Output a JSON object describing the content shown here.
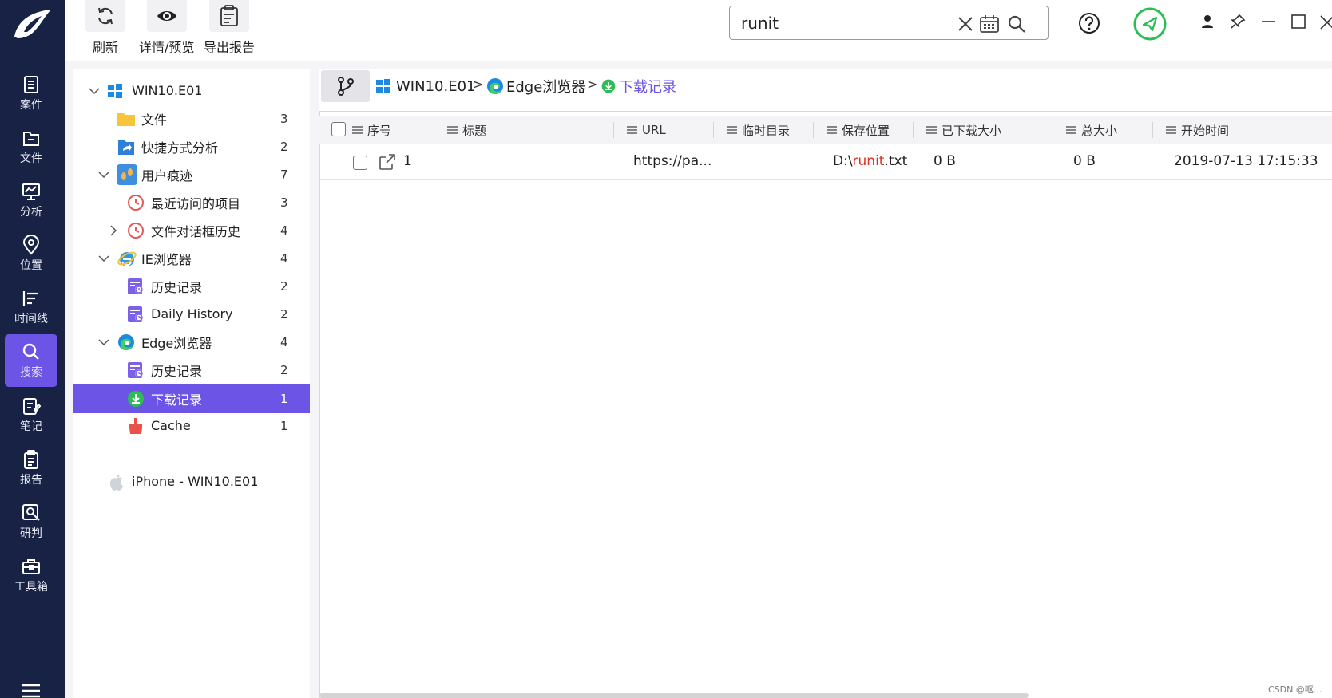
{
  "nav": {
    "items": [
      {
        "label": "案件",
        "icon": "case-icon"
      },
      {
        "label": "文件",
        "icon": "file-icon"
      },
      {
        "label": "分析",
        "icon": "analysis-icon"
      },
      {
        "label": "位置",
        "icon": "location-icon"
      },
      {
        "label": "时间线",
        "icon": "timeline-icon"
      },
      {
        "label": "搜索",
        "icon": "search-icon",
        "active": true
      },
      {
        "label": "笔记",
        "icon": "notes-icon"
      },
      {
        "label": "报告",
        "icon": "report-icon"
      },
      {
        "label": "研判",
        "icon": "judgement-icon"
      },
      {
        "label": "工具箱",
        "icon": "toolbox-icon"
      }
    ]
  },
  "toolbar": {
    "refresh_label": "刷新",
    "detail_label": "详情/预览",
    "export_label": "导出报告"
  },
  "search": {
    "value": "runit"
  },
  "tree": {
    "items": [
      {
        "label": "WIN10.E01",
        "count": "",
        "icon": "windows-icon"
      },
      {
        "label": "文件",
        "count": "3",
        "icon": "folder-icon"
      },
      {
        "label": "快捷方式分析",
        "count": "2",
        "icon": "shortcut-icon"
      },
      {
        "label": "用户痕迹",
        "count": "7",
        "icon": "footprints-icon"
      },
      {
        "label": "最近访问的项目",
        "count": "3",
        "icon": "clock-icon"
      },
      {
        "label": "文件对话框历史",
        "count": "4",
        "icon": "clock-icon"
      },
      {
        "label": "IE浏览器",
        "count": "4",
        "icon": "ie-icon"
      },
      {
        "label": "历史记录",
        "count": "2",
        "icon": "history-icon"
      },
      {
        "label": "Daily History",
        "count": "2",
        "icon": "history-icon"
      },
      {
        "label": "Edge浏览器",
        "count": "4",
        "icon": "edge-icon"
      },
      {
        "label": "历史记录",
        "count": "2",
        "icon": "history-icon"
      },
      {
        "label": "下载记录",
        "count": "1",
        "icon": "download-icon",
        "selected": true
      },
      {
        "label": "Cache",
        "count": "1",
        "icon": "cache-icon"
      },
      {
        "label": "iPhone - WIN10.E01",
        "count": "",
        "icon": "apple-icon"
      }
    ]
  },
  "breadcrumb": {
    "items": [
      "WIN10.E01",
      "Edge浏览器",
      "下载记录"
    ],
    "separator": ">"
  },
  "table": {
    "columns": [
      "序号",
      "标题",
      "URL",
      "临时目录",
      "保存位置",
      "已下载大小",
      "总大小",
      "开始时间"
    ],
    "rows": [
      {
        "index": "1",
        "title": "",
        "url": "https://pa...",
        "temp_dir": "",
        "save_prefix": "D:\\",
        "save_match": "runit",
        "save_suffix": ".txt",
        "downloaded": "0 B",
        "total": "0 B",
        "start_time": "2019-07-13 17:15:33"
      }
    ]
  },
  "watermark": "CSDN @呕...",
  "colors": {
    "rail": "#172245",
    "accent": "#6b54e6",
    "match_highlight": "#e0301e",
    "status_green": "#2dbd55"
  }
}
